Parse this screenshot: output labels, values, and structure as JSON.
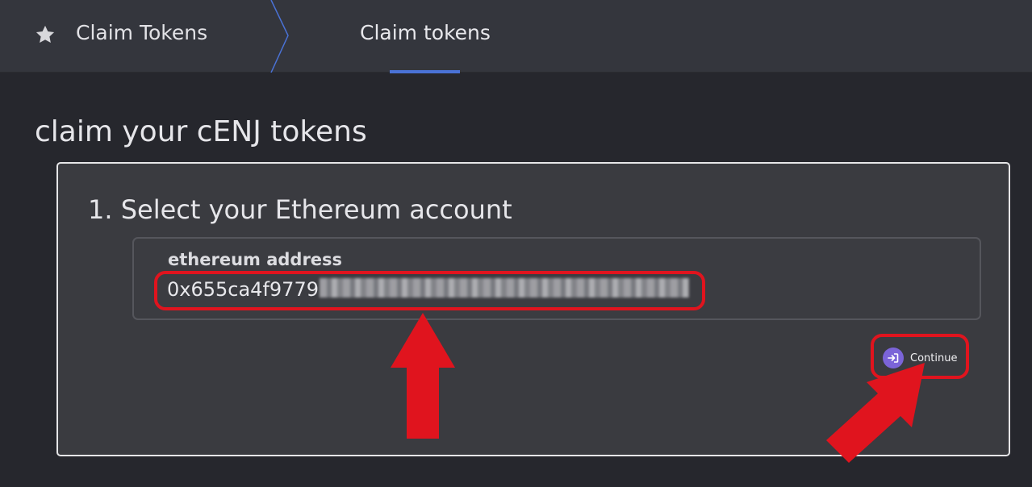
{
  "breadcrumb": {
    "home_label": "Claim Tokens",
    "home_icon": "star-icon",
    "current_tab": "Claim tokens"
  },
  "page": {
    "title": "claim your cENJ tokens"
  },
  "step": {
    "title": "1. Select your Ethereum account",
    "field_label": "ethereum address",
    "address_visible": "0x655ca4f9779"
  },
  "actions": {
    "continue_label": "Continue",
    "continue_icon": "sign-in-icon"
  },
  "colors": {
    "topbar": "#34363d",
    "background": "#26272d",
    "card": "#3a3b40",
    "accent": "#4a72d6",
    "button": "#7b64d8",
    "annotation": "#e0141e"
  }
}
